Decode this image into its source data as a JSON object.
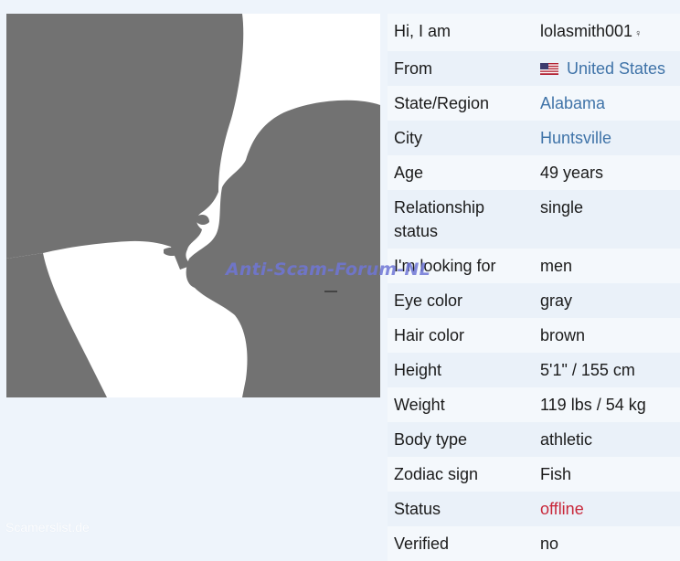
{
  "watermark": "Anti-Scam-Forum-NL",
  "corner_watermark": "Scamerslist.de",
  "profile": {
    "rows": [
      {
        "label": "Hi, I am",
        "value": "lolasmith001",
        "gender_icon": "female-icon"
      },
      {
        "label": "From",
        "value": "United States",
        "flag": "us-flag-icon"
      },
      {
        "label": "State/Region",
        "value": "Alabama"
      },
      {
        "label": "City",
        "value": "Huntsville"
      },
      {
        "label": "Age",
        "value": "49 years"
      },
      {
        "label": "Relationship status",
        "value": "single"
      },
      {
        "label": "I'm looking for",
        "value": "men"
      },
      {
        "label": "Eye color",
        "value": "gray"
      },
      {
        "label": "Hair color",
        "value": "brown"
      },
      {
        "label": "Height",
        "value": "5'1\" / 155 cm"
      },
      {
        "label": "Weight",
        "value": "119 lbs / 54 kg"
      },
      {
        "label": "Body type",
        "value": "athletic"
      },
      {
        "label": "Zodiac sign",
        "value": "Fish"
      },
      {
        "label": "Status",
        "value": "offline"
      },
      {
        "label": "Verified",
        "value": "no"
      }
    ]
  },
  "colors": {
    "link": "#3f73a8",
    "offline": "#c8273a",
    "silhouette": "#727272"
  }
}
